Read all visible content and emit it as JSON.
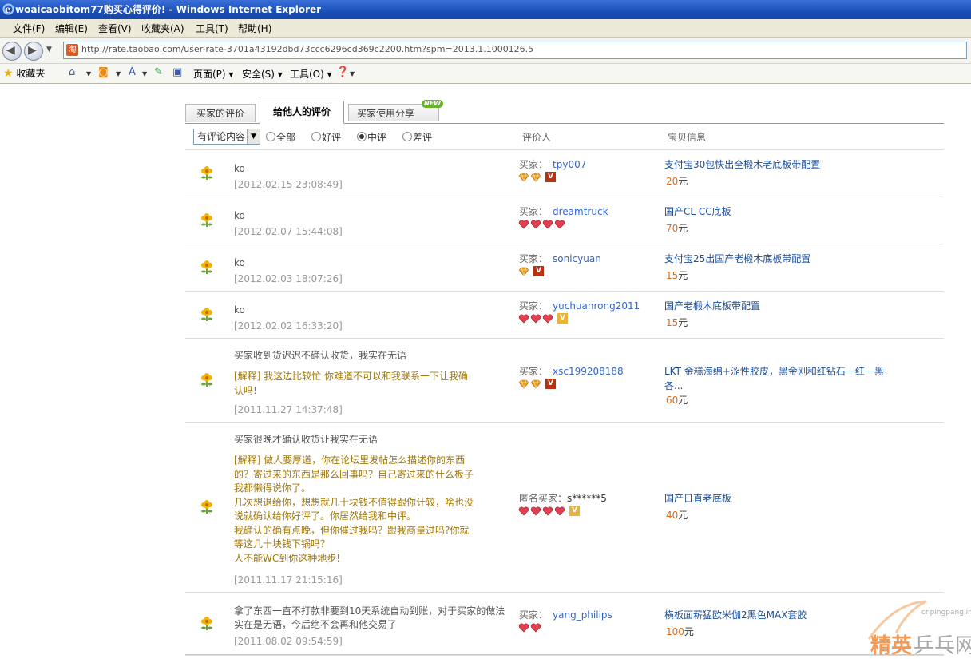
{
  "window": {
    "title": "woaicaobitom77购买心得评价! - Windows Internet Explorer"
  },
  "menu": [
    "文件(F)",
    "编辑(E)",
    "查看(V)",
    "收藏夹(A)",
    "工具(T)",
    "帮助(H)"
  ],
  "address": {
    "url": "http://rate.taobao.com/user-rate-3701a43192dbd73ccc6296cd369c2200.htm?spm=2013.1.1000126.5",
    "favicon": "淘"
  },
  "commandbar": {
    "favorites": "收藏夹",
    "page": "页面(P)",
    "safety": "安全(S)",
    "tools": "工具(O)"
  },
  "tabs": [
    "买家的评价",
    "给他人的评价",
    "买家使用分享"
  ],
  "new_badge": "NEW",
  "filter": {
    "select_value": "有评论内容",
    "radios": [
      "全部",
      "好评",
      "中评",
      "差评"
    ],
    "selected": "中评",
    "col_rater": "评价人",
    "col_item": "宝贝信息"
  },
  "reviews": [
    {
      "comment": "ko",
      "date": "[2012.02.15 23:08:49]",
      "rater_label": "买家：",
      "rater": "tpy007",
      "gems": 2,
      "gem_color": "#e8a020",
      "vip": "red",
      "item": "支付宝30包快出全椴木老底板带配置",
      "price": "20",
      "unit": "元"
    },
    {
      "comment": "ko",
      "date": "[2012.02.07 15:44:08]",
      "rater_label": "买家：",
      "rater": "dreamtruck",
      "gems": 4,
      "gem_color": "#e04050",
      "vip": "none",
      "item": "国产CL CC底板",
      "price": "70",
      "unit": "元"
    },
    {
      "comment": "ko",
      "date": "[2012.02.03 18:07:26]",
      "rater_label": "买家：",
      "rater": "sonicyuan",
      "gems": 1,
      "gem_color": "#e8a020",
      "vip": "red",
      "item": "支付宝25出国产老椴木底板带配置",
      "price": "15",
      "unit": "元"
    },
    {
      "comment": "ko",
      "date": "[2012.02.02 16:33:20]",
      "rater_label": "买家：",
      "rater": "yuchuanrong2011",
      "gems": 3,
      "gem_color": "#e04050",
      "vip": "gold",
      "item": "国产老椴木底板带配置",
      "price": "15",
      "unit": "元"
    },
    {
      "comment": "买家收到货迟迟不确认收货，我实在无语",
      "explain": [
        "[解释] 我这边比较忙  你难道不可以和我联系一下让我确",
        "认吗!"
      ],
      "date": "[2011.11.27 14:37:48]",
      "rater_label": "买家：",
      "rater": "xsc199208188",
      "gems": 2,
      "gem_color": "#e8a020",
      "vip": "red",
      "item": "LKT       金糕海绵+涩性胶皮，黑金刚和红钻石一红一黑",
      "item2": "各...",
      "price": "60",
      "unit": "元"
    },
    {
      "comment": "买家很晚才确认收货让我实在无语",
      "explain": [
        "[解释]   做人要厚道，你在论坛里发帖怎么描述你的东西",
        "的？寄过来的东西是那么回事吗？自己寄过来的什么板子",
        "我都懒得说你了。",
        "几次想退给你，想想就几十块钱不值得跟你计较，啥也没",
        "说就确认给你好评了。你居然给我和中评。",
        "我确认的确有点晚，但你催过我吗？跟我商量过吗?你就",
        "等这几十块钱下锅吗？",
        "人不能WC到你这种地步!"
      ],
      "date": "[2011.11.17 21:15:16]",
      "rater_label": "匿名买家：",
      "rater": "s******5",
      "gems": 4,
      "gem_color": "#e04050",
      "vip": "gold",
      "item": "国产日直老底板",
      "price": "40",
      "unit": "元"
    },
    {
      "comment": "拿了东西一直不打款非要到10天系统自动到账，对于买家的做法",
      "comment2": "实在是无语，今后绝不会再和他交易了",
      "date": "[2011.08.02 09:54:59]",
      "rater_label": "买家：",
      "rater": "yang_philips",
      "gems": 2,
      "gem_color": "#e04050",
      "vip": "none",
      "item": "横板面菥猛欧米伽2黑色MAX套胶",
      "price": "100",
      "unit": "元"
    }
  ],
  "watermark": {
    "site": "cnpingpang.info",
    "text": "精英乒乓网"
  }
}
